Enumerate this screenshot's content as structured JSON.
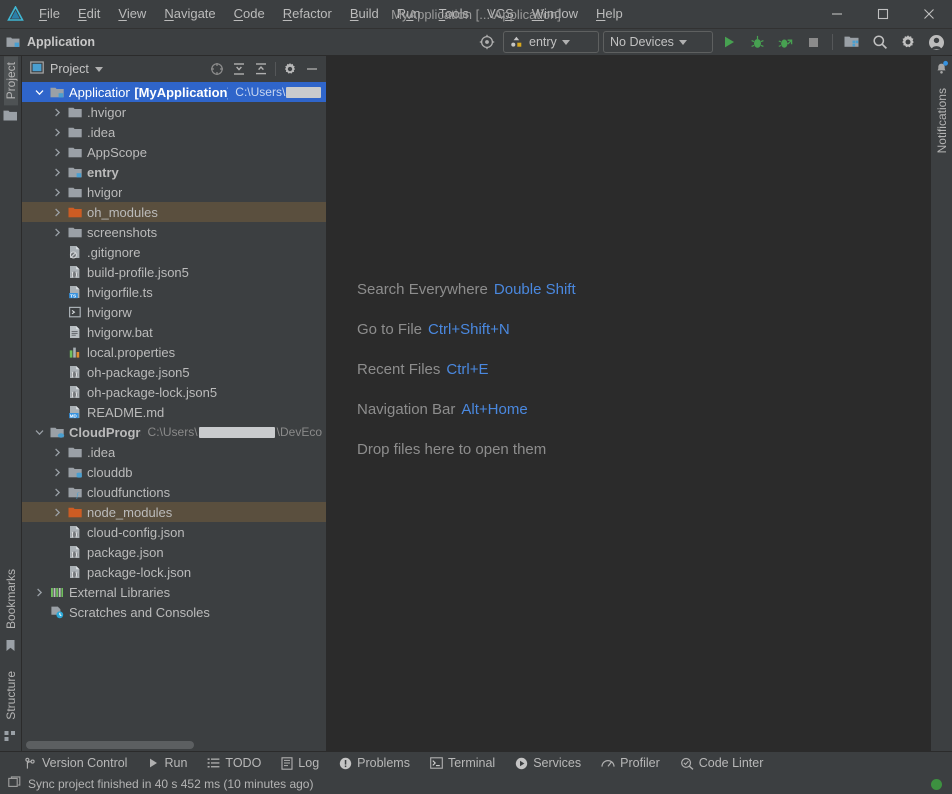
{
  "window": {
    "title": "MyApplication [...\\Application]",
    "minimize_label": "—",
    "maximize_label": "☐",
    "close_label": "✕"
  },
  "menu": {
    "items": [
      {
        "label": "File",
        "mnemonic": "F"
      },
      {
        "label": "Edit",
        "mnemonic": "E"
      },
      {
        "label": "View",
        "mnemonic": "V"
      },
      {
        "label": "Navigate",
        "mnemonic": "N"
      },
      {
        "label": "Code",
        "mnemonic": "C"
      },
      {
        "label": "Refactor",
        "mnemonic": "R"
      },
      {
        "label": "Build",
        "mnemonic": "B"
      },
      {
        "label": "Run",
        "mnemonic": "u"
      },
      {
        "label": "Tools",
        "mnemonic": "T"
      },
      {
        "label": "VCS",
        "mnemonic": "S"
      },
      {
        "label": "Window",
        "mnemonic": "W"
      },
      {
        "label": "Help",
        "mnemonic": "H"
      }
    ]
  },
  "toolbar": {
    "breadcrumb": "Application",
    "run_config": "entry",
    "device_selector": "No Devices",
    "icons": [
      "target-icon",
      "run-icon",
      "debug-icon",
      "profile-icon",
      "stop-icon",
      "device-manager-icon",
      "search-icon",
      "settings-icon",
      "account-icon"
    ]
  },
  "left_strip": {
    "project_tab": "Project",
    "bookmarks_tab": "Bookmarks",
    "structure_tab": "Structure"
  },
  "right_strip": {
    "notifications_tab": "Notifications"
  },
  "project_panel": {
    "title": "Project",
    "header_icons": [
      "select-opened-file-icon",
      "expand-all-icon",
      "collapse-all-icon",
      "settings-icon",
      "hide-icon"
    ],
    "tree": [
      {
        "indent": 0,
        "arrow": "down",
        "icon": "module-folder-icon",
        "label": "Application",
        "suffix": "[MyApplication]",
        "path": "C:\\Users\\",
        "redacted": true,
        "state": "selected"
      },
      {
        "indent": 1,
        "arrow": "right",
        "icon": "folder-icon",
        "label": ".hvigor"
      },
      {
        "indent": 1,
        "arrow": "right",
        "icon": "folder-icon",
        "label": ".idea"
      },
      {
        "indent": 1,
        "arrow": "right",
        "icon": "folder-icon",
        "label": "AppScope"
      },
      {
        "indent": 1,
        "arrow": "right",
        "icon": "module-folder-icon",
        "label": "entry",
        "bold": true
      },
      {
        "indent": 1,
        "arrow": "right",
        "icon": "folder-icon",
        "label": "hvigor"
      },
      {
        "indent": 1,
        "arrow": "right",
        "icon": "excluded-folder-icon",
        "label": "oh_modules",
        "state": "highlighted"
      },
      {
        "indent": 1,
        "arrow": "right",
        "icon": "folder-icon",
        "label": "screenshots"
      },
      {
        "indent": 1,
        "arrow": "none",
        "icon": "gitignore-file-icon",
        "label": ".gitignore"
      },
      {
        "indent": 1,
        "arrow": "none",
        "icon": "json5-file-icon",
        "label": "build-profile.json5"
      },
      {
        "indent": 1,
        "arrow": "none",
        "icon": "ts-file-icon",
        "label": "hvigorfile.ts"
      },
      {
        "indent": 1,
        "arrow": "none",
        "icon": "shell-file-icon",
        "label": "hvigorw"
      },
      {
        "indent": 1,
        "arrow": "none",
        "icon": "bat-file-icon",
        "label": "hvigorw.bat"
      },
      {
        "indent": 1,
        "arrow": "none",
        "icon": "properties-file-icon",
        "label": "local.properties"
      },
      {
        "indent": 1,
        "arrow": "none",
        "icon": "json5-file-icon",
        "label": "oh-package.json5"
      },
      {
        "indent": 1,
        "arrow": "none",
        "icon": "json5-file-icon",
        "label": "oh-package-lock.json5"
      },
      {
        "indent": 1,
        "arrow": "none",
        "icon": "markdown-file-icon",
        "label": "README.md"
      },
      {
        "indent": 0,
        "arrow": "down",
        "icon": "cloud-module-icon",
        "label": "CloudProgram",
        "bold": true,
        "path": "C:\\Users\\",
        "path_tail": "\\DevEco",
        "redacted": true
      },
      {
        "indent": 1,
        "arrow": "right",
        "icon": "folder-icon",
        "label": ".idea"
      },
      {
        "indent": 1,
        "arrow": "right",
        "icon": "db-folder-icon",
        "label": "clouddb"
      },
      {
        "indent": 1,
        "arrow": "right",
        "icon": "fn-folder-icon",
        "label": "cloudfunctions"
      },
      {
        "indent": 1,
        "arrow": "right",
        "icon": "excluded-folder-icon",
        "label": "node_modules",
        "state": "highlighted"
      },
      {
        "indent": 1,
        "arrow": "none",
        "icon": "json-file-icon",
        "label": "cloud-config.json"
      },
      {
        "indent": 1,
        "arrow": "none",
        "icon": "json-file-icon",
        "label": "package.json"
      },
      {
        "indent": 1,
        "arrow": "none",
        "icon": "json-file-icon",
        "label": "package-lock.json"
      },
      {
        "indent": 0,
        "arrow": "right",
        "icon": "libraries-icon",
        "label": "External Libraries"
      },
      {
        "indent": 0,
        "arrow": "none",
        "icon": "scratches-icon",
        "label": "Scratches and Consoles"
      }
    ]
  },
  "editor": {
    "hints": [
      {
        "label": "Search Everywhere",
        "shortcut": "Double Shift"
      },
      {
        "label": "Go to File",
        "shortcut": "Ctrl+Shift+N"
      },
      {
        "label": "Recent Files",
        "shortcut": "Ctrl+E"
      },
      {
        "label": "Navigation Bar",
        "shortcut": "Alt+Home"
      },
      {
        "label": "Drop files here to open them",
        "shortcut": ""
      }
    ]
  },
  "tool_windows": [
    {
      "label": "Version Control",
      "icon": "branch-icon"
    },
    {
      "label": "Run",
      "icon": "run-icon"
    },
    {
      "label": "TODO",
      "icon": "todo-icon"
    },
    {
      "label": "Log",
      "icon": "log-icon"
    },
    {
      "label": "Problems",
      "icon": "problems-icon"
    },
    {
      "label": "Terminal",
      "icon": "terminal-icon"
    },
    {
      "label": "Services",
      "icon": "services-icon"
    },
    {
      "label": "Profiler",
      "icon": "profiler-icon"
    },
    {
      "label": "Code Linter",
      "icon": "code-linter-icon"
    }
  ],
  "status_bar": {
    "message": "Sync project finished in 40 s 452 ms (10 minutes ago)",
    "indicator_color": "#3d9140"
  },
  "colors": {
    "accent_blue": "#2f65ca",
    "link_blue": "#4a88df",
    "panel_bg": "#3c3f41",
    "editor_bg": "#2b2b2b",
    "highlight_brown": "#5a4f3e",
    "folder_orange": "#cc5c23"
  }
}
